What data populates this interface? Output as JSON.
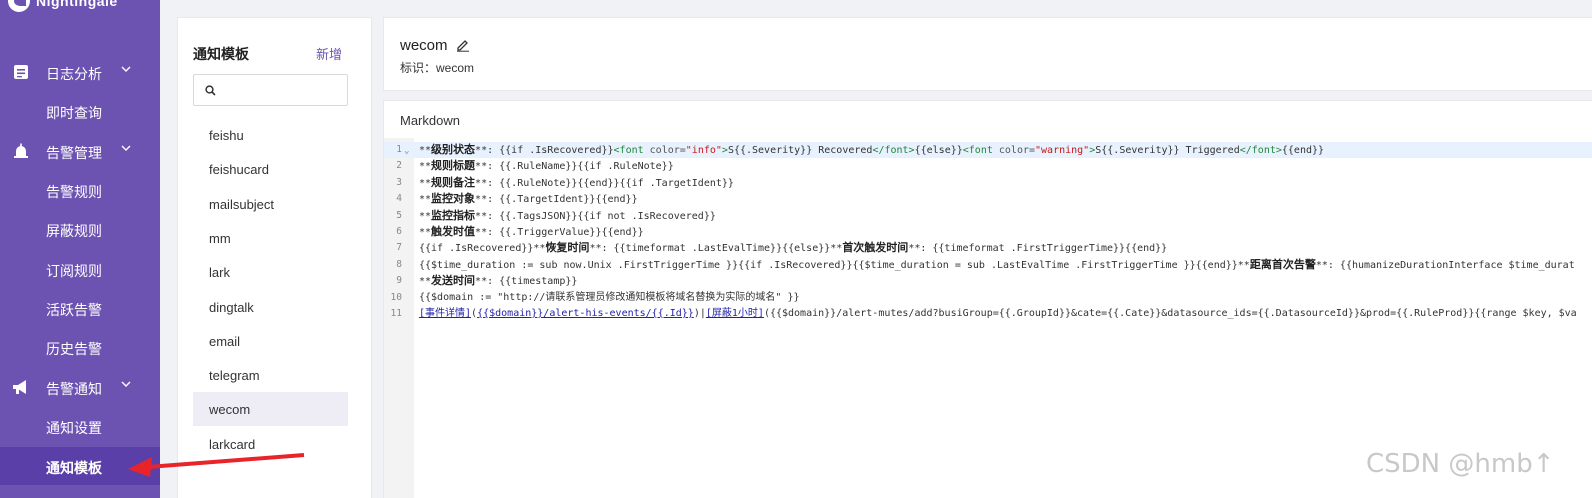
{
  "brand": {
    "name": "Nightingale"
  },
  "sidebar": {
    "groups": [
      {
        "label": "日志分析",
        "icon": "log-analysis-icon"
      },
      {
        "label": "告警管理",
        "icon": "alarm-bell-icon"
      },
      {
        "label": "告警通知",
        "icon": "megaphone-icon"
      }
    ],
    "items": [
      {
        "label": "即时查询"
      },
      {
        "label": "告警规则"
      },
      {
        "label": "屏蔽规则"
      },
      {
        "label": "订阅规则"
      },
      {
        "label": "活跃告警"
      },
      {
        "label": "历史告警"
      },
      {
        "label": "通知设置"
      },
      {
        "label": "通知模板"
      }
    ]
  },
  "templates_panel": {
    "title": "通知模板",
    "add_label": "新增",
    "search": {
      "value": "",
      "placeholder": ""
    },
    "items": [
      "feishu",
      "feishucard",
      "mailsubject",
      "mm",
      "lark",
      "dingtalk",
      "email",
      "telegram",
      "wecom",
      "larkcard"
    ],
    "selected": "wecom"
  },
  "header": {
    "name": "wecom",
    "ident_label": "标识：",
    "ident_value": "wecom"
  },
  "editor": {
    "title": "Markdown",
    "lines": [
      {
        "n": "1",
        "parts": [
          {
            "t": "**",
            "c": ""
          },
          {
            "t": "级别状态",
            "c": "b"
          },
          {
            "t": "**: {{if .IsRecovered}}",
            "c": ""
          },
          {
            "t": "<font ",
            "c": "tag"
          },
          {
            "t": "color=",
            "c": "attr"
          },
          {
            "t": "\"info\"",
            "c": "str"
          },
          {
            "t": ">",
            "c": "tag"
          },
          {
            "t": "S{{.Severity}} Recovered",
            "c": ""
          },
          {
            "t": "</font>",
            "c": "tag"
          },
          {
            "t": "{{else}}",
            "c": ""
          },
          {
            "t": "<font ",
            "c": "tag"
          },
          {
            "t": "color=",
            "c": "attr"
          },
          {
            "t": "\"warning\"",
            "c": "str"
          },
          {
            "t": ">",
            "c": "tag"
          },
          {
            "t": "S{{.Severity}} Triggered",
            "c": ""
          },
          {
            "t": "</font>",
            "c": "tag"
          },
          {
            "t": "{{end}}",
            "c": ""
          }
        ]
      },
      {
        "n": "2",
        "parts": [
          {
            "t": "**",
            "c": ""
          },
          {
            "t": "规则标题",
            "c": "b"
          },
          {
            "t": "**: {{.RuleName}}{{if .RuleNote}}",
            "c": ""
          }
        ]
      },
      {
        "n": "3",
        "parts": [
          {
            "t": "**",
            "c": ""
          },
          {
            "t": "规则备注",
            "c": "b"
          },
          {
            "t": "**: {{.RuleNote}}{{end}}{{if .TargetIdent}}",
            "c": ""
          }
        ]
      },
      {
        "n": "4",
        "parts": [
          {
            "t": "**",
            "c": ""
          },
          {
            "t": "监控对象",
            "c": "b"
          },
          {
            "t": "**: {{.TargetIdent}}{{end}}",
            "c": ""
          }
        ]
      },
      {
        "n": "5",
        "parts": [
          {
            "t": "**",
            "c": ""
          },
          {
            "t": "监控指标",
            "c": "b"
          },
          {
            "t": "**: {{.TagsJSON}}{{if not .IsRecovered}}",
            "c": ""
          }
        ]
      },
      {
        "n": "6",
        "parts": [
          {
            "t": "**",
            "c": ""
          },
          {
            "t": "触发时值",
            "c": "b"
          },
          {
            "t": "**: {{.TriggerValue}}{{end}}",
            "c": ""
          }
        ]
      },
      {
        "n": "7",
        "parts": [
          {
            "t": "{{if .IsRecovered}}**",
            "c": ""
          },
          {
            "t": "恢复时间",
            "c": "b"
          },
          {
            "t": "**: {{timeformat .LastEvalTime}}{{else}}**",
            "c": ""
          },
          {
            "t": "首次触发时间",
            "c": "b"
          },
          {
            "t": "**: {{timeformat .FirstTriggerTime}}{{end}}",
            "c": ""
          }
        ]
      },
      {
        "n": "8",
        "parts": [
          {
            "t": "{{$time_duration := sub now.Unix .FirstTriggerTime }}{{if .IsRecovered}}{{$time_duration = sub .LastEvalTime .FirstTriggerTime }}{{end}}**",
            "c": ""
          },
          {
            "t": "距离首次告警",
            "c": "b"
          },
          {
            "t": "**: {{humanizeDurationInterface $time_durat",
            "c": ""
          }
        ]
      },
      {
        "n": "9",
        "parts": [
          {
            "t": "**",
            "c": ""
          },
          {
            "t": "发送时间",
            "c": "b"
          },
          {
            "t": "**: {{timestamp}}",
            "c": ""
          }
        ]
      },
      {
        "n": "10",
        "parts": [
          {
            "t": "{{$domain := \"http://请联系管理员修改通知模板将域名替换为实际的域名\" }}",
            "c": ""
          }
        ]
      },
      {
        "n": "11",
        "parts": [
          {
            "t": "[事件详情]",
            "c": "lnk"
          },
          {
            "t": "(",
            "c": ""
          },
          {
            "t": "{{$domain}}/alert-his-events/{{.Id}}",
            "c": "lnk"
          },
          {
            "t": ")|",
            "c": ""
          },
          {
            "t": "[屏蔽1小时]",
            "c": "lnk"
          },
          {
            "t": "({{$domain}}/alert-mutes/add?busiGroup={{.GroupId}}&cate={{.Cate}}&datasource_ids={{.DatasourceId}}&prod={{.RuleProd}}{{range $key, $va",
            "c": ""
          }
        ]
      }
    ]
  },
  "watermark": "CSDN @hmb↑",
  "colors": {
    "sidebar": "#6c53b1",
    "accent": "#6c53b1",
    "arrow": "#e8242a"
  }
}
